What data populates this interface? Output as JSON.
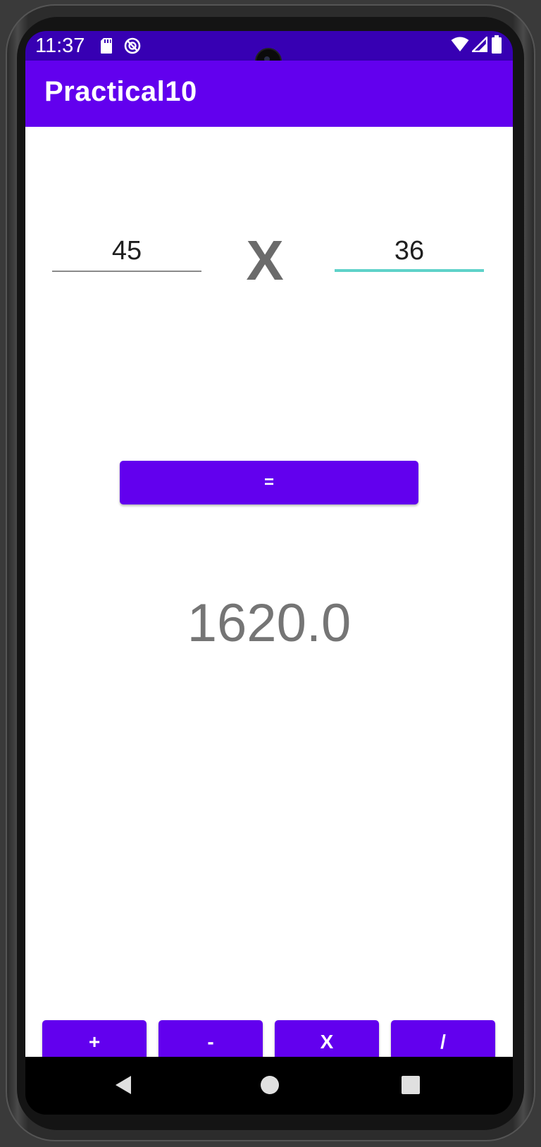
{
  "status_bar": {
    "time": "11:37",
    "left_icons": [
      "sd-card-icon",
      "do-not-disturb-icon"
    ],
    "right_icons": [
      "wifi-icon",
      "signal-icon",
      "battery-icon"
    ]
  },
  "app_bar": {
    "title": "Practical10"
  },
  "calculator": {
    "first_operand": "45",
    "operator": "X",
    "second_operand": "36",
    "equals_label": "=",
    "result": "1620.0"
  },
  "operator_buttons": [
    {
      "label": "+"
    },
    {
      "label": "-"
    },
    {
      "label": "X"
    },
    {
      "label": "/"
    }
  ],
  "navigation": {
    "icons": [
      "back-icon",
      "home-icon",
      "recents-icon"
    ]
  },
  "colors": {
    "primary": "#6200ee",
    "primary_dark": "#3700b3",
    "focus_underline": "#5fd2c9",
    "result_text": "#757575"
  }
}
